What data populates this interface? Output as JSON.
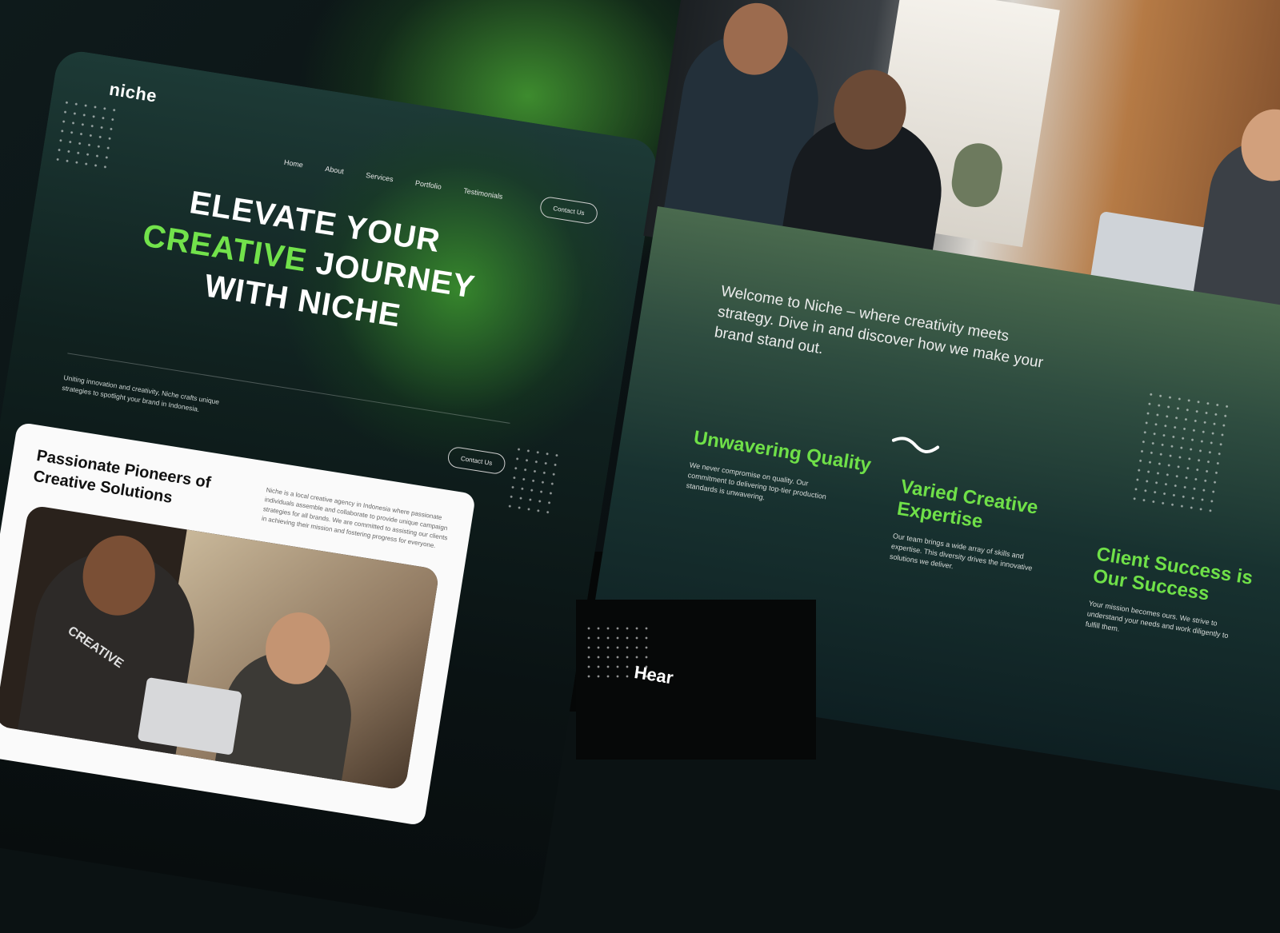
{
  "left_page": {
    "logo": "niche",
    "nav": [
      "Home",
      "About",
      "Services",
      "Portfolio",
      "Testimonials"
    ],
    "contact_button": "Contact Us",
    "headline": {
      "line1": "ELEVATE YOUR",
      "highlight": "CREATIVE",
      "line2_rest": " JOURNEY",
      "line3": "WITH NICHE"
    },
    "hero_subtitle": "Uniting innovation and creativity, Niche crafts unique strategies to spotlight your brand in Indonesia.",
    "contact_button_2": "Contact Us",
    "about": {
      "title": "Passionate Pioneers of Creative Solutions",
      "text": "Niche is a local creative agency in Indonesia where passionate individuals assemble and collaborate to provide unique campaign strategies for all brands. We are committed to assisting our clients in achieving their mission and fostering progress for everyone.",
      "shirt_text": "CREATIVE"
    }
  },
  "right_page": {
    "welcome": "Welcome to Niche – where creativity meets strategy. Dive in and discover how we make your brand stand out.",
    "features": [
      {
        "title": "Unwavering Quality",
        "text": "We never compromise on quality. Our commitment to delivering top-tier production standards is unwavering."
      },
      {
        "title": "Varied Creative Expertise",
        "text": "Our team brings a wide array of skills and expertise. This diversity drives the innovative solutions we deliver."
      },
      {
        "title": "Client Success is Our Success",
        "text": "Your mission becomes ours. We strive to understand your needs and work diligently to fulfill them."
      }
    ],
    "next_section_heading": "Hear"
  },
  "colors": {
    "accent": "#72e24b",
    "background": "#0b1213",
    "card": "#fafafa"
  }
}
